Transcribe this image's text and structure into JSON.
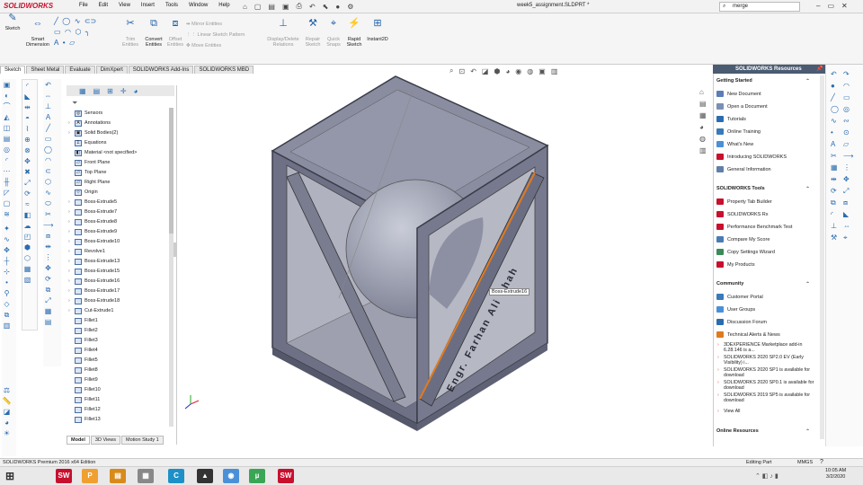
{
  "app": {
    "logo_text": "SOLIDWORKS",
    "menu": [
      "File",
      "Edit",
      "View",
      "Insert",
      "Tools",
      "Window",
      "Help"
    ],
    "doc_title": "week5_assignment.SLDPRT *",
    "search_value": "merge"
  },
  "cmd": {
    "sketch": "Sketch",
    "smart_dim": "Smart\nDimension",
    "trim": "Trim\nEntities",
    "convert": "Convert\nEntities",
    "offset": "Offset\nEntities",
    "mirror": "Mirror Entities",
    "linear": "Linear Sketch Pattern",
    "move": "Move Entities",
    "display_delete": "Display/Delete\nRelations",
    "repair": "Repair\nSketch",
    "quick": "Quick\nSnaps",
    "rapid": "Rapid\nSketch",
    "instant2d": "Instant2D"
  },
  "tabs": [
    "Sketch",
    "Sheet Metal",
    "Evaluate",
    "DimXpert",
    "SOLIDWORKS Add-Ins",
    "SOLIDWORKS MBD"
  ],
  "tree": [
    {
      "label": "Sensors",
      "arrow": ""
    },
    {
      "label": "Annotations",
      "arrow": "›"
    },
    {
      "label": "Solid Bodies(2)",
      "arrow": "›"
    },
    {
      "label": "Equations",
      "arrow": ""
    },
    {
      "label": "Material <not specified>",
      "arrow": ""
    },
    {
      "label": "Front Plane",
      "arrow": ""
    },
    {
      "label": "Top Plane",
      "arrow": ""
    },
    {
      "label": "Right Plane",
      "arrow": ""
    },
    {
      "label": "Origin",
      "arrow": ""
    },
    {
      "label": "Boss-Extrude5",
      "arrow": "›"
    },
    {
      "label": "Boss-Extrude7",
      "arrow": "›"
    },
    {
      "label": "Boss-Extrude8",
      "arrow": "›"
    },
    {
      "label": "Boss-Extrude9",
      "arrow": "›"
    },
    {
      "label": "Boss-Extrude10",
      "arrow": "›"
    },
    {
      "label": "Revolve1",
      "arrow": "›"
    },
    {
      "label": "Boss-Extrude13",
      "arrow": "›"
    },
    {
      "label": "Boss-Extrude15",
      "arrow": "›"
    },
    {
      "label": "Boss-Extrude16",
      "arrow": "›"
    },
    {
      "label": "Boss-Extrude17",
      "arrow": "›"
    },
    {
      "label": "Boss-Extrude18",
      "arrow": "›"
    },
    {
      "label": "Cut-Extrude1",
      "arrow": "›"
    },
    {
      "label": "Fillet1",
      "arrow": ""
    },
    {
      "label": "Fillet2",
      "arrow": ""
    },
    {
      "label": "Fillet3",
      "arrow": ""
    },
    {
      "label": "Fillet4",
      "arrow": ""
    },
    {
      "label": "Fillet5",
      "arrow": ""
    },
    {
      "label": "Fillet8",
      "arrow": ""
    },
    {
      "label": "Fillet9",
      "arrow": ""
    },
    {
      "label": "Fillet10",
      "arrow": ""
    },
    {
      "label": "Fillet11",
      "arrow": ""
    },
    {
      "label": "Fillet12",
      "arrow": ""
    },
    {
      "label": "Fillet13",
      "arrow": ""
    }
  ],
  "bottom_tabs": [
    "Model",
    "3D Views",
    "Motion Study 1"
  ],
  "viewport": {
    "tooltip": "Boss-Extrude16",
    "engraving": "Engr. Farhan Ali Shah"
  },
  "taskpane": {
    "title": "SOLIDWORKS Resources",
    "getting_started": "Getting Started",
    "gs_links": [
      "New Document",
      "Open a Document",
      "Tutorials",
      "Online Training",
      "What's New",
      "Introducing SOLIDWORKS",
      "General Information"
    ],
    "tools": "SOLIDWORKS Tools",
    "tool_links": [
      "Property Tab Builder",
      "SOLIDWORKS Rx",
      "Performance Benchmark Test",
      "Compare My Score",
      "Copy Settings Wizard",
      "My Products"
    ],
    "community": "Community",
    "community_links": [
      "Customer Portal",
      "User Groups",
      "Discussion Forum",
      "Technical Alerts & News"
    ],
    "news": [
      "3DEXPERIENCE Marketplace add-in 6.28.146 is a...",
      "SOLIDWORKS 2020 SP2.0 EV (Early Visibility) i...",
      "SOLIDWORKS 2020 SP1 is available for download",
      "SOLIDWORKS 2020 SP0.1 is available for download",
      "SOLIDWORKS 2019 SP5 is available for download"
    ],
    "view_all": "View All",
    "online_resources": "Online Resources"
  },
  "status": {
    "edition": "SOLIDWORKS Premium 2016 x64 Edition",
    "mode": "Editing Part",
    "units": "MMGS"
  },
  "clock": {
    "time": "10:05 AM",
    "date": "3/2/2020"
  }
}
